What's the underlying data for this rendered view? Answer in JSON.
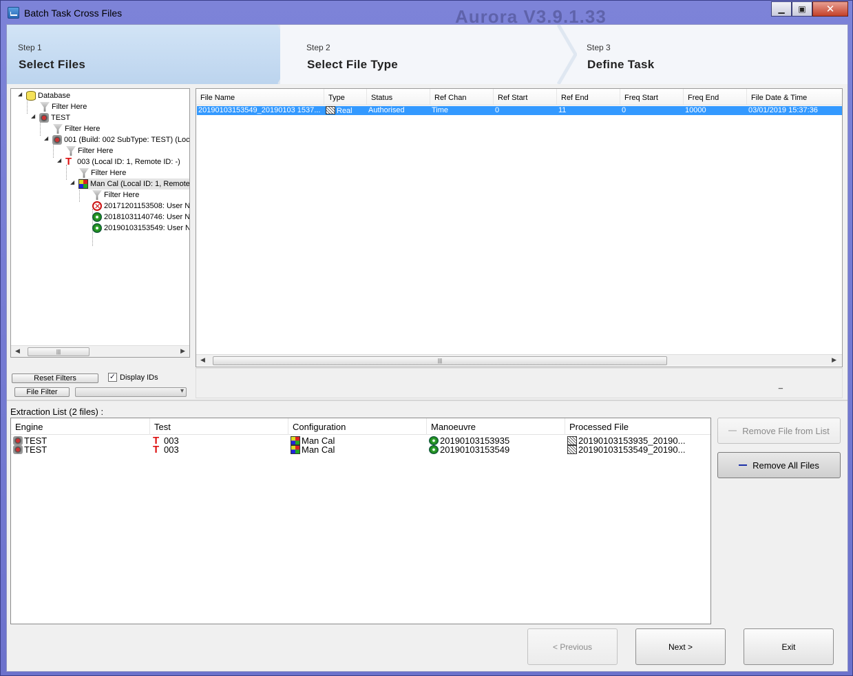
{
  "window": {
    "title": "Batch Task Cross Files",
    "ghost_title": "Aurora V3.9.1.33"
  },
  "steps": [
    {
      "small": "Step 1",
      "big": "Select Files"
    },
    {
      "small": "Step 2",
      "big": "Select File Type"
    },
    {
      "small": "Step 3",
      "big": "Define Task"
    }
  ],
  "tree": {
    "nodes": [
      {
        "label": "Database",
        "icon": "database-icon"
      },
      {
        "label": "Filter Here",
        "icon": "filter-icon"
      },
      {
        "label": "TEST",
        "icon": "engine-icon"
      },
      {
        "label": "Filter Here",
        "icon": "filter-icon"
      },
      {
        "label": "001 (Build: 002  SubType: TEST) (Loc",
        "icon": "build-icon"
      },
      {
        "label": "Filter Here",
        "icon": "filter-icon"
      },
      {
        "label": "003 (Local ID: 1, Remote ID: -)",
        "icon": "test-icon"
      },
      {
        "label": "Filter Here",
        "icon": "filter-icon"
      },
      {
        "label": "Man Cal (Local ID: 1, Remote",
        "icon": "configuration-icon"
      },
      {
        "label": "Filter Here",
        "icon": "filter-icon"
      },
      {
        "label": "20171201153508: User N",
        "icon": "rejected-icon"
      },
      {
        "label": "20181031140746: User N",
        "icon": "manoeuvre-ok-icon"
      },
      {
        "label": "20190103153549: User N",
        "icon": "manoeuvre-ok-icon"
      }
    ],
    "reset_filters": "Reset Filters",
    "display_ids": "Display IDs",
    "display_ids_checked": true,
    "file_filter": "File Filter"
  },
  "grid": {
    "columns": [
      "File Name",
      "Type",
      "Status",
      "Ref Chan",
      "Ref Start",
      "Ref End",
      "Freq Start",
      "Freq End",
      "File Date & Time"
    ],
    "rows": [
      [
        "20190103153549_20190103 1537...",
        "Real",
        "Authorised",
        "Time",
        "0",
        "11",
        "0",
        "10000",
        "03/01/2019 15:37:36"
      ]
    ],
    "status_text": "_"
  },
  "extraction": {
    "label": "Extraction List (2 files) :",
    "columns": [
      "Engine",
      "Test",
      "Configuration",
      "Manoeuvre",
      "Processed File"
    ],
    "rows": [
      [
        "TEST",
        "003",
        "Man Cal",
        "20190103153935",
        "20190103153935_20190..."
      ],
      [
        "TEST",
        "003",
        "Man Cal",
        "20190103153549",
        "20190103153549_20190..."
      ]
    ],
    "remove_file": "Remove File from List",
    "remove_all": "Remove All Files"
  },
  "nav": {
    "previous": "< Previous",
    "next": "Next >",
    "exit": "Exit"
  },
  "colors": {
    "selection": "#3399ff",
    "step_active": "#c4dbf2",
    "remove_accent": "#1a2fa8"
  }
}
